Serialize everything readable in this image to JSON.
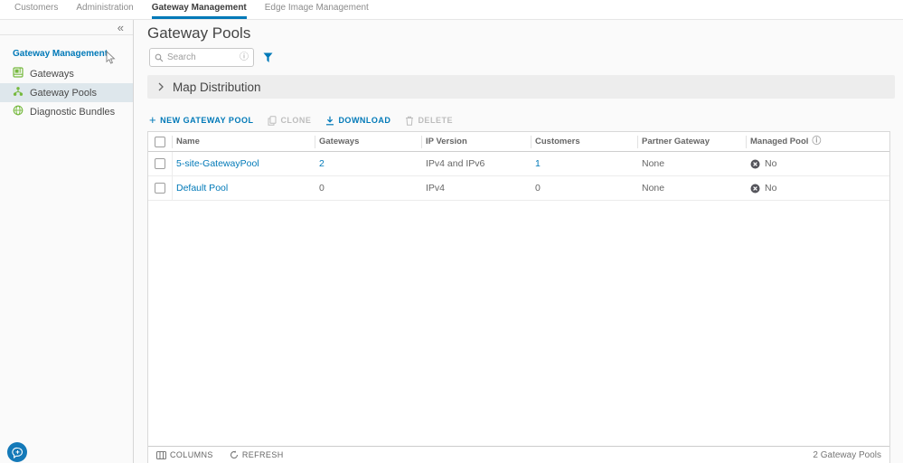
{
  "topnav": {
    "tabs": [
      {
        "label": "Customers",
        "active": false
      },
      {
        "label": "Administration",
        "active": false
      },
      {
        "label": "Gateway Management",
        "active": true
      },
      {
        "label": "Edge Image Management",
        "active": false
      }
    ]
  },
  "sidebar": {
    "collapse_icon": "«",
    "section_title": "Gateway Management",
    "items": [
      {
        "label": "Gateways",
        "icon": "gateways-icon",
        "selected": false
      },
      {
        "label": "Gateway Pools",
        "icon": "gateway-pools-icon",
        "selected": true
      },
      {
        "label": "Diagnostic Bundles",
        "icon": "diagnostic-bundles-icon",
        "selected": false
      }
    ]
  },
  "main": {
    "title": "Gateway Pools",
    "search": {
      "placeholder": "Search",
      "info_icon": "ⓘ"
    },
    "map_section": {
      "label": "Map Distribution"
    },
    "toolbar": {
      "new_label": "NEW GATEWAY POOL",
      "clone_label": "CLONE",
      "download_label": "DOWNLOAD",
      "delete_label": "DELETE"
    },
    "table": {
      "columns": [
        "Name",
        "Gateways",
        "IP Version",
        "Customers",
        "Partner Gateway",
        "Managed Pool"
      ],
      "managed_pool_info_icon": "ⓘ",
      "rows": [
        {
          "name": "5-site-GatewayPool",
          "gateways": "2",
          "ip_version": "IPv4 and IPv6",
          "customers": "1",
          "partner_gateway": "None",
          "managed_pool": "No"
        },
        {
          "name": "Default Pool",
          "gateways": "0",
          "ip_version": "IPv4",
          "customers": "0",
          "partner_gateway": "None",
          "managed_pool": "No"
        }
      ]
    },
    "footer": {
      "columns_label": "COLUMNS",
      "refresh_label": "REFRESH",
      "count": "2 Gateway Pools"
    }
  },
  "colors": {
    "accent_blue": "#0079B8",
    "icon_green": "#76B93E",
    "selected_item_bg": "#DEE7EC",
    "disabled_gray": "#BDBDBD",
    "managed_no_icon": "#54545B",
    "content_bg": "#FAFAFA"
  }
}
